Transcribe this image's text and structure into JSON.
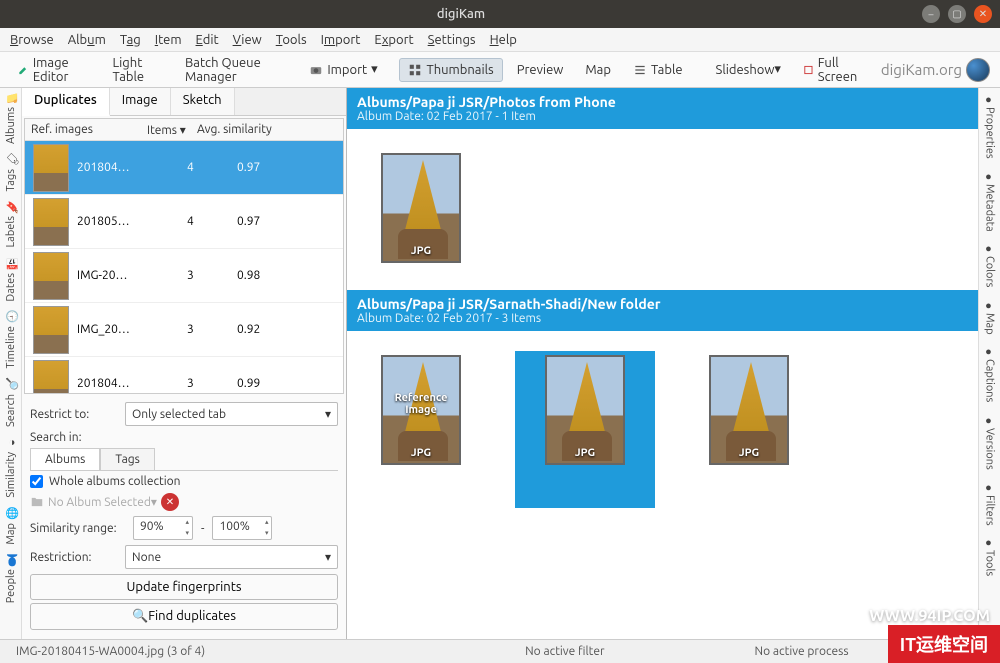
{
  "window": {
    "title": "digiKam"
  },
  "menubar": {
    "browse": "Browse",
    "album": "Album",
    "tag": "Tag",
    "item": "Item",
    "edit": "Edit",
    "view": "View",
    "tools": "Tools",
    "import": "Import",
    "export": "Export",
    "settings": "Settings",
    "help": "Help"
  },
  "toolbar": {
    "image_editor": "Image Editor",
    "light_table": "Light Table",
    "bqm": "Batch Queue Manager",
    "import": "Import",
    "thumbnails": "Thumbnails",
    "preview": "Preview",
    "map": "Map",
    "table": "Table",
    "slideshow": "Slideshow",
    "fullscreen": "Full Screen",
    "brand": "digiKam.org"
  },
  "left_vtabs": [
    "Albums",
    "Tags",
    "Labels",
    "Dates",
    "Timeline",
    "Search",
    "Similarity",
    "Map",
    "People"
  ],
  "right_vtabs": [
    "Properties",
    "Metadata",
    "Colors",
    "Map",
    "Captions",
    "Versions",
    "Filters",
    "Tools"
  ],
  "left_tabs": {
    "duplicates": "Duplicates",
    "image": "Image",
    "sketch": "Sketch"
  },
  "dup_headers": {
    "ref": "Ref. images",
    "items": "Items",
    "sim": "Avg. similarity"
  },
  "dup_rows": [
    {
      "name": "201804…",
      "items": "4",
      "sim": "0.97",
      "sel": true
    },
    {
      "name": "201805…",
      "items": "4",
      "sim": "0.97",
      "sel": false
    },
    {
      "name": "IMG-20…",
      "items": "3",
      "sim": "0.98",
      "sel": false
    },
    {
      "name": "IMG_20…",
      "items": "3",
      "sim": "0.92",
      "sel": false
    },
    {
      "name": "201804…",
      "items": "3",
      "sim": "0.99",
      "sel": false
    }
  ],
  "controls": {
    "restrict_to_label": "Restrict to:",
    "restrict_to_value": "Only selected tab",
    "search_in_label": "Search in:",
    "subtabs": {
      "albums": "Albums",
      "tags": "Tags"
    },
    "whole_albums": "Whole albums collection",
    "no_album": "No Album Selected",
    "sim_range_label": "Similarity range:",
    "sim_min": "90%",
    "sim_dash": "-",
    "sim_max": "100%",
    "restriction_label": "Restriction:",
    "restriction_value": "None",
    "update_btn": "Update fingerprints",
    "find_btn": "Find duplicates"
  },
  "albums": [
    {
      "path": "Albums/Papa ji JSR/Photos from Phone",
      "meta": "Album Date: 02 Feb 2017 - 1 Item",
      "items": [
        {
          "fmt": "JPG",
          "ref": false,
          "sel": false
        }
      ]
    },
    {
      "path": "Albums/Papa ji JSR/Sarnath-Shadi/New folder",
      "meta": "Album Date: 02 Feb 2017 - 3 Items",
      "items": [
        {
          "fmt": "JPG",
          "ref": true,
          "ref_label": "Reference Image",
          "sel": false
        },
        {
          "fmt": "JPG",
          "ref": false,
          "sel": true
        },
        {
          "fmt": "JPG",
          "ref": false,
          "sel": false
        }
      ]
    }
  ],
  "statusbar": {
    "file": "IMG-20180415-WA0004.jpg (3 of 4)",
    "filter": "No active filter",
    "process": "No active process"
  },
  "watermark": {
    "site": "WWW.94IP.COM",
    "brand": "IT运维空间"
  }
}
